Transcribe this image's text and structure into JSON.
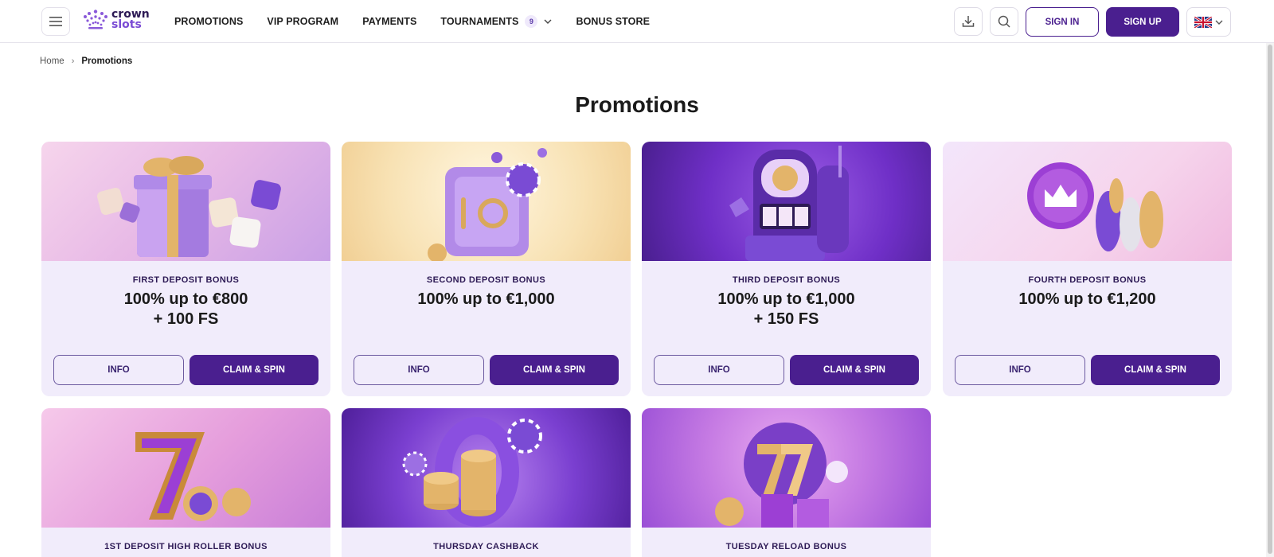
{
  "brand": {
    "name_line1": "crown",
    "name_line2": "slots"
  },
  "nav": [
    {
      "label": "PROMOTIONS"
    },
    {
      "label": "VIP PROGRAM"
    },
    {
      "label": "PAYMENTS"
    },
    {
      "label": "TOURNAMENTS",
      "badge": "9"
    },
    {
      "label": "BONUS STORE"
    }
  ],
  "header": {
    "signin_label": "SIGN IN",
    "signup_label": "SIGN UP"
  },
  "breadcrumb": {
    "home": "Home",
    "separator": "›",
    "current": "Promotions"
  },
  "page": {
    "title": "Promotions"
  },
  "promotions": [
    {
      "label": "FIRST DEPOSIT BONUS",
      "value_line1": "100% up to €800",
      "value_line2": "+ 100 FS",
      "info_label": "INFO",
      "claim_label": "CLAIM & SPIN"
    },
    {
      "label": "SECOND DEPOSIT BONUS",
      "value_line1": "100% up to €1,000",
      "value_line2": "",
      "info_label": "INFO",
      "claim_label": "CLAIM & SPIN"
    },
    {
      "label": "THIRD DEPOSIT BONUS",
      "value_line1": "100% up to €1,000",
      "value_line2": "+ 150 FS",
      "info_label": "INFO",
      "claim_label": "CLAIM & SPIN"
    },
    {
      "label": "FOURTH DEPOSIT BONUS",
      "value_line1": "100% up to €1,200",
      "value_line2": "",
      "info_label": "INFO",
      "claim_label": "CLAIM & SPIN"
    },
    {
      "label": "1ST DEPOSIT HIGH ROLLER BONUS"
    },
    {
      "label": "THURSDAY CASHBACK"
    },
    {
      "label": "TUESDAY RELOAD BONUS"
    }
  ],
  "colors": {
    "brand_purple": "#4a1f8f",
    "card_bg": "#f1ecfb",
    "accent": "#7a4bd4"
  },
  "icons": [
    "menu-icon",
    "crown-logo-icon",
    "chevron-down-icon",
    "download-icon",
    "search-icon",
    "uk-flag-icon",
    "chevron-right-icon"
  ]
}
